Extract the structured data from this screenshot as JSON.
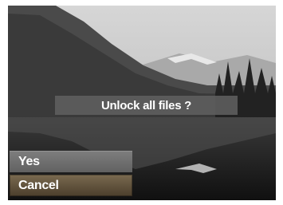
{
  "dialog": {
    "message": "Unlock all files ?"
  },
  "menu": {
    "items": [
      {
        "label": "Yes",
        "selected": false
      },
      {
        "label": "Cancel",
        "selected": true
      }
    ]
  },
  "colors": {
    "dialog_bg": "#5f5f5f",
    "menu_item_bg": "#6e6e6e",
    "menu_item_selected_bg": "#5f4f3a",
    "text": "#ffffff"
  }
}
